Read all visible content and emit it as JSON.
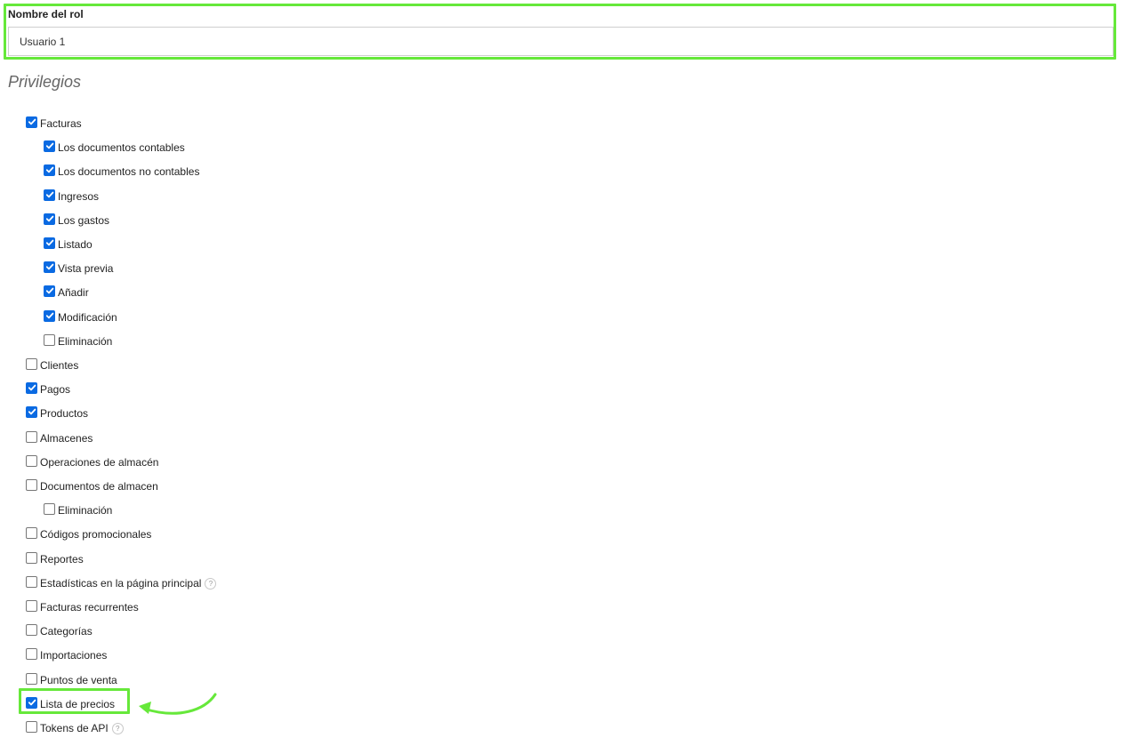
{
  "role": {
    "label": "Nombre del rol",
    "value": "Usuario 1"
  },
  "section_title": "Privilegios",
  "privileges": [
    {
      "label": "Facturas",
      "checked": true,
      "level": 0
    },
    {
      "label": "Los documentos contables",
      "checked": true,
      "level": 1
    },
    {
      "label": "Los documentos no contables",
      "checked": true,
      "level": 1
    },
    {
      "label": "Ingresos",
      "checked": true,
      "level": 1
    },
    {
      "label": "Los gastos",
      "checked": true,
      "level": 1
    },
    {
      "label": "Listado",
      "checked": true,
      "level": 1
    },
    {
      "label": "Vista previa",
      "checked": true,
      "level": 1
    },
    {
      "label": "Añadir",
      "checked": true,
      "level": 1
    },
    {
      "label": "Modificación",
      "checked": true,
      "level": 1
    },
    {
      "label": "Eliminación",
      "checked": false,
      "level": 1
    },
    {
      "label": "Clientes",
      "checked": false,
      "level": 0
    },
    {
      "label": "Pagos",
      "checked": true,
      "level": 0
    },
    {
      "label": "Productos",
      "checked": true,
      "level": 0
    },
    {
      "label": "Almacenes",
      "checked": false,
      "level": 0
    },
    {
      "label": "Operaciones de almacén",
      "checked": false,
      "level": 0
    },
    {
      "label": "Documentos de almacen",
      "checked": false,
      "level": 0
    },
    {
      "label": "Eliminación",
      "checked": false,
      "level": 1
    },
    {
      "label": "Códigos promocionales",
      "checked": false,
      "level": 0
    },
    {
      "label": "Reportes",
      "checked": false,
      "level": 0
    },
    {
      "label": "Estadísticas en la página principal",
      "checked": false,
      "level": 0,
      "help": "?"
    },
    {
      "label": "Facturas recurrentes",
      "checked": false,
      "level": 0
    },
    {
      "label": "Categorías",
      "checked": false,
      "level": 0
    },
    {
      "label": "Importaciones",
      "checked": false,
      "level": 0
    },
    {
      "label": "Puntos de venta",
      "checked": false,
      "level": 0
    },
    {
      "label": "Lista de precios",
      "checked": true,
      "level": 0
    },
    {
      "label": "Tokens de API",
      "checked": false,
      "level": 0,
      "help": "?"
    }
  ],
  "highlight_color": "#66e83a",
  "checkbox_checked_color": "#0a6ae2"
}
